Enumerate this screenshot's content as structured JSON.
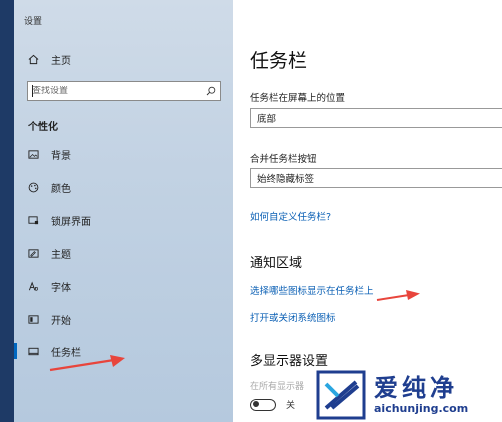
{
  "window": {
    "title": "设置"
  },
  "sidebar": {
    "home_label": "主页",
    "search": {
      "placeholder": "查找设置"
    },
    "section_title": "个性化",
    "items": [
      {
        "label": "背景",
        "icon": "picture-icon"
      },
      {
        "label": "颜色",
        "icon": "palette-icon"
      },
      {
        "label": "锁屏界面",
        "icon": "lock-screen-icon"
      },
      {
        "label": "主题",
        "icon": "theme-icon"
      },
      {
        "label": "字体",
        "icon": "font-icon"
      },
      {
        "label": "开始",
        "icon": "start-icon"
      },
      {
        "label": "任务栏",
        "icon": "taskbar-icon",
        "active": true
      }
    ]
  },
  "main": {
    "title": "任务栏",
    "position_label": "任务栏在屏幕上的位置",
    "position_value": "底部",
    "combine_label": "合并任务栏按钮",
    "combine_value": "始终隐藏标签",
    "customize_link": "如何自定义任务栏?",
    "notification_heading": "通知区域",
    "select_icons_link": "选择哪些图标显示在任务栏上",
    "system_icons_link": "打开或关闭系统图标",
    "multi_display_heading": "多显示器设置",
    "multi_display_label": "在所有显示器",
    "toggle_state": "关"
  },
  "watermark": {
    "text": "爱纯净",
    "url": "aichunjing.com"
  },
  "colors": {
    "accent": "#0067c0",
    "link": "#0a5fb4",
    "arrow": "#e8453c",
    "watermark": "#1f3e8f"
  }
}
